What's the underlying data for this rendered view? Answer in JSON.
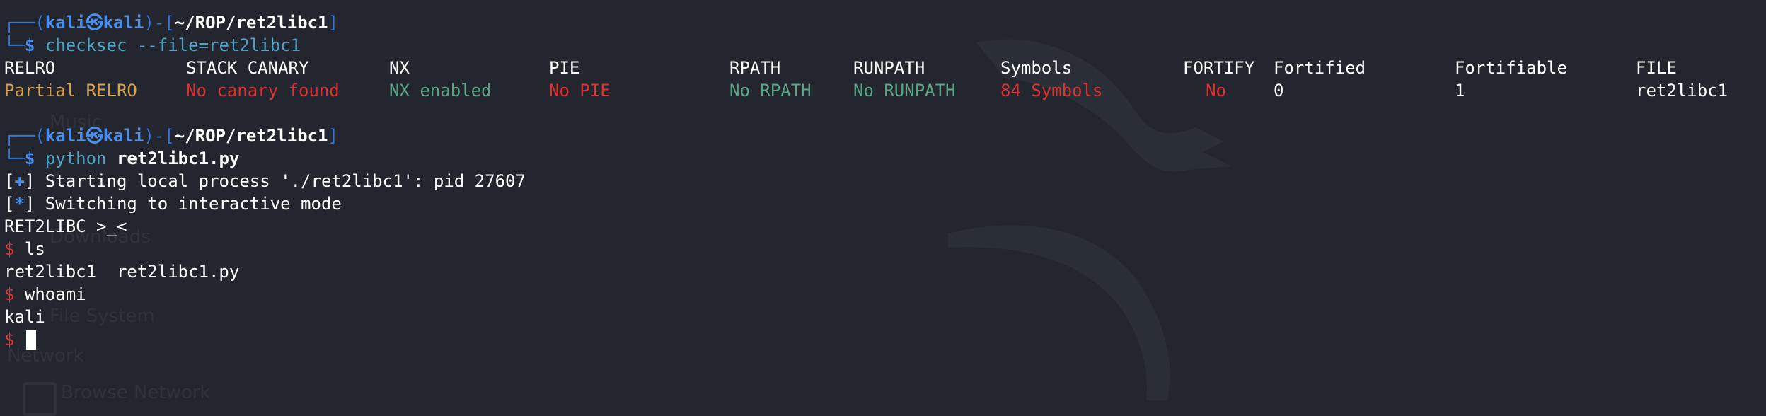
{
  "prompt": {
    "frame_top_open": "┌──(",
    "user": "kali",
    "at": "㉿",
    "host": "kali",
    "mid": ")-[",
    "path": "~/ROP/ret2libc1",
    "close": "]",
    "frame_bottom": "└─",
    "dollar": "$"
  },
  "commands": {
    "checksec": "checksec --file=ret2libc1",
    "python_cmd": "python",
    "python_arg": "ret2libc1.py"
  },
  "checksec_table": {
    "headers": [
      "RELRO",
      "STACK CANARY",
      "NX",
      "PIE",
      "RPATH",
      "RUNPATH",
      "Symbols",
      "FORTIFY",
      "Fortified",
      "Fortifiable",
      "FILE"
    ],
    "values": [
      "Partial RELRO",
      "No canary found",
      "NX enabled",
      "No PIE",
      "No RPATH",
      "No RUNPATH",
      "84 Symbols",
      "No",
      "0",
      "1",
      "ret2libc1"
    ],
    "value_colors": [
      "#d6a04c",
      "#e03131",
      "#5aa488",
      "#e03131",
      "#5aa488",
      "#5aa488",
      "#e03131",
      "#e03131",
      "#ffffff",
      "#ffffff",
      "#ffffff"
    ]
  },
  "output": {
    "start_prefix": "[",
    "start_mark": "+",
    "start_suffix": "]",
    "start_text": " Starting local process './ret2libc1': pid 27607",
    "switch_prefix": "[",
    "switch_mark": "*",
    "switch_suffix": "]",
    "switch_text": " Switching to interactive mode",
    "banner": "RET2LIBC >_<",
    "shell_prompt": "$",
    "ls_cmd": " ls",
    "ls_output": "ret2libc1  ret2libc1.py",
    "whoami_cmd": " whoami",
    "whoami_output": "kali"
  },
  "background": {
    "ghost_items": [
      "Music",
      "Downloads",
      "File System",
      "Network",
      "Browse Network"
    ],
    "colors": {
      "bg": "#23262e",
      "accent": "#3477d6"
    }
  }
}
